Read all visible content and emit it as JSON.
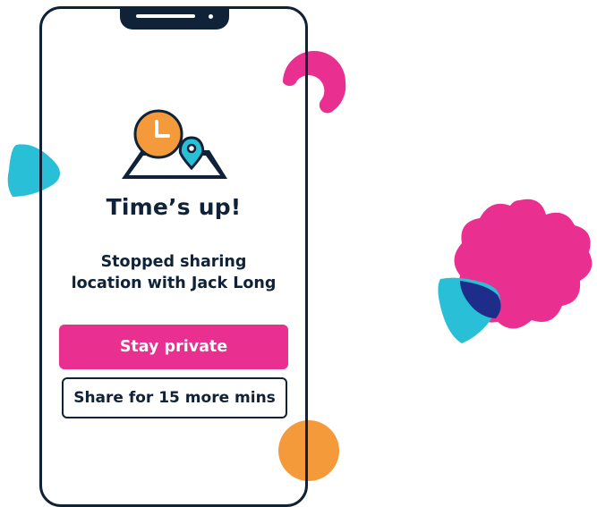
{
  "dialog": {
    "title": "Time’s up!",
    "message_line1": "Stopped sharing",
    "message_line2": "location with Jack Long"
  },
  "actions": {
    "primary_label": "Stay private",
    "secondary_label": "Share for 15 more mins"
  },
  "colors": {
    "brand_pink": "#e92f8f",
    "navy": "#0f2238",
    "teal": "#29bfd6",
    "orange": "#f59a3a",
    "indigo": "#1e2c8a"
  },
  "icons": [
    "clock-icon",
    "map-icon",
    "location-pin-icon"
  ]
}
